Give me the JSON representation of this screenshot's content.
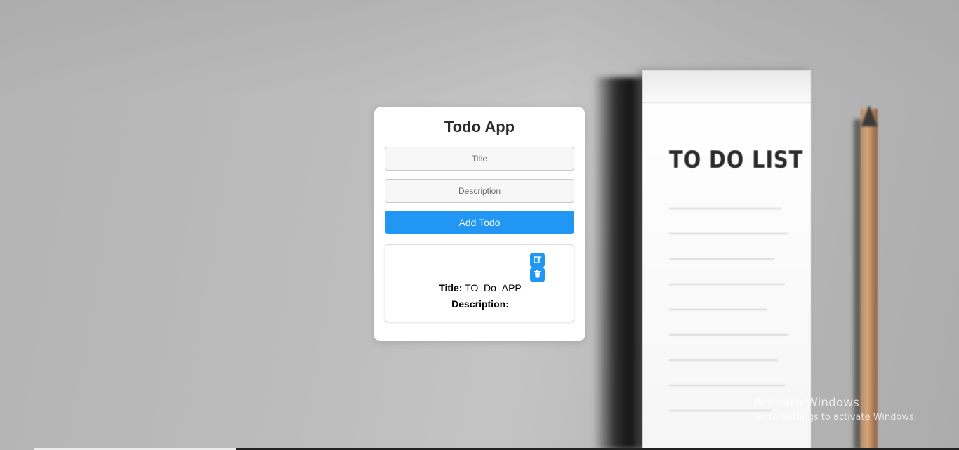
{
  "background": {
    "notepad_heading": "TO DO LIST"
  },
  "app": {
    "title": "Todo App",
    "title_input": {
      "placeholder": "Title",
      "value": ""
    },
    "description_input": {
      "placeholder": "Description",
      "value": ""
    },
    "add_button_label": "Add Todo",
    "accent_color": "#2196f3",
    "todos": [
      {
        "title_label": "Title:",
        "title": "TO_Do_APP",
        "description_label": "Description:",
        "description": "",
        "edit_icon": "edit-icon",
        "delete_icon": "trash-icon"
      }
    ]
  },
  "watermark": {
    "title": "Activate Windows",
    "subtitle": "Go to Settings to activate Windows."
  }
}
